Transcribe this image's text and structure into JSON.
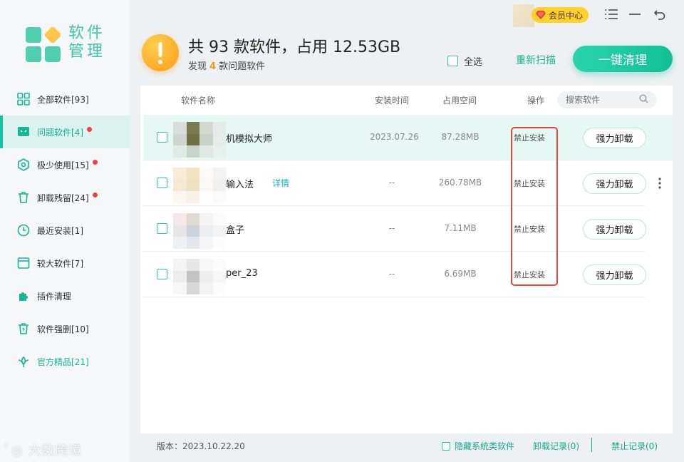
{
  "app": {
    "title_line1": "软件",
    "title_line2": "管理",
    "vip_label": "会员中心"
  },
  "sidebar": {
    "items": [
      {
        "label": "全部软件[93]",
        "icon": "grid-icon"
      },
      {
        "label": "问题软件[4]",
        "icon": "monitor-icon",
        "dot": true
      },
      {
        "label": "极少使用[15]",
        "icon": "hexagon-icon",
        "dot": true
      },
      {
        "label": "卸载残留[24]",
        "icon": "trash-icon",
        "dot": true
      },
      {
        "label": "最近安装[1]",
        "icon": "clock-icon"
      },
      {
        "label": "较大软件[7]",
        "icon": "window-icon"
      },
      {
        "label": "插件清理",
        "icon": "puzzle-icon"
      },
      {
        "label": "软件强删[10]",
        "icon": "trash-lightning-icon"
      },
      {
        "label": "官方精品[21]",
        "icon": "lotus-icon"
      }
    ]
  },
  "header": {
    "title": "共 93 款软件，占用 12.53GB",
    "subtitle_prefix": "发现",
    "problem_count": "4",
    "subtitle_suffix": "款问题软件",
    "select_all": "全选",
    "rescan": "重新扫描",
    "clean_button": "一键清理"
  },
  "table": {
    "columns": {
      "name": "软件名称",
      "install_time": "安装时间",
      "size": "占用空间",
      "action": "操作"
    },
    "search_placeholder": "搜索软件",
    "rows": [
      {
        "name": "机模拟大师",
        "date": "2023.07.26",
        "size": "87.28MB",
        "status": "禁止安装",
        "button": "强力卸载"
      },
      {
        "name": "输入法",
        "detail": "详情",
        "date": "--",
        "size": "260.78MB",
        "status": "禁止安装",
        "button": "强力卸载"
      },
      {
        "name": "盒子",
        "date": "--",
        "size": "7.11MB",
        "status": "禁止安装",
        "button": "强力卸载"
      },
      {
        "name": "per_23",
        "date": "--",
        "size": "6.69MB",
        "status": "禁止安装",
        "button": "强力卸载"
      }
    ]
  },
  "footer": {
    "version": "版本：2023.10.22.20",
    "hide_system": "隐藏系统类软件",
    "uninstall_log": "卸载记录(0)",
    "forbid_log": "禁止记录(0)",
    "watermark": "大数跨境"
  },
  "colors": {
    "accent": "#16c2a0",
    "warning": "#ff9b1a",
    "highlight_box": "#e0453f",
    "vip": "#ffd22b"
  }
}
